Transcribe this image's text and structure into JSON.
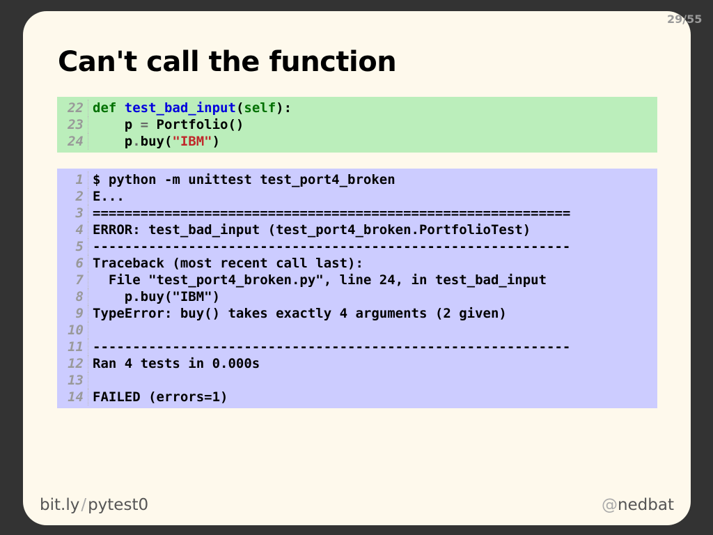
{
  "page_number": "29/55",
  "title": "Can't call the function",
  "code_block": {
    "lines": [
      {
        "num": "22",
        "tokens": [
          {
            "t": "def",
            "c": "k"
          },
          {
            "t": " ",
            "c": ""
          },
          {
            "t": "test_bad_input",
            "c": "f"
          },
          {
            "t": "(",
            "c": ""
          },
          {
            "t": "self",
            "c": "k"
          },
          {
            "t": "):",
            "c": ""
          }
        ]
      },
      {
        "num": "23",
        "tokens": [
          {
            "t": "    p ",
            "c": ""
          },
          {
            "t": "=",
            "c": "o"
          },
          {
            "t": " Portfolio()",
            "c": ""
          }
        ]
      },
      {
        "num": "24",
        "tokens": [
          {
            "t": "    p",
            "c": ""
          },
          {
            "t": ".",
            "c": "o"
          },
          {
            "t": "buy(",
            "c": ""
          },
          {
            "t": "\"IBM\"",
            "c": "s"
          },
          {
            "t": ")",
            "c": ""
          }
        ]
      }
    ]
  },
  "terminal_block": {
    "lines": [
      {
        "num": "1",
        "text": "$ python -m unittest test_port4_broken"
      },
      {
        "num": "2",
        "text": "E..."
      },
      {
        "num": "3",
        "text": "============================================================"
      },
      {
        "num": "4",
        "text": "ERROR: test_bad_input (test_port4_broken.PortfolioTest)"
      },
      {
        "num": "5",
        "text": "------------------------------------------------------------"
      },
      {
        "num": "6",
        "text": "Traceback (most recent call last):"
      },
      {
        "num": "7",
        "text": "  File \"test_port4_broken.py\", line 24, in test_bad_input"
      },
      {
        "num": "8",
        "text": "    p.buy(\"IBM\")"
      },
      {
        "num": "9",
        "text": "TypeError: buy() takes exactly 4 arguments (2 given)"
      },
      {
        "num": "10",
        "text": ""
      },
      {
        "num": "11",
        "text": "------------------------------------------------------------"
      },
      {
        "num": "12",
        "text": "Ran 4 tests in 0.000s"
      },
      {
        "num": "13",
        "text": ""
      },
      {
        "num": "14",
        "text": "FAILED (errors=1)"
      }
    ]
  },
  "footer": {
    "left_host": "bit.ly",
    "left_sep": "/",
    "left_path": "pytest0",
    "right_at": "@",
    "right_handle": "nedbat"
  },
  "colors": {
    "slide_bg": "#fef9ec",
    "code_bg": "#bbeebb",
    "terminal_bg": "#ccccff",
    "frame": "#333333"
  }
}
